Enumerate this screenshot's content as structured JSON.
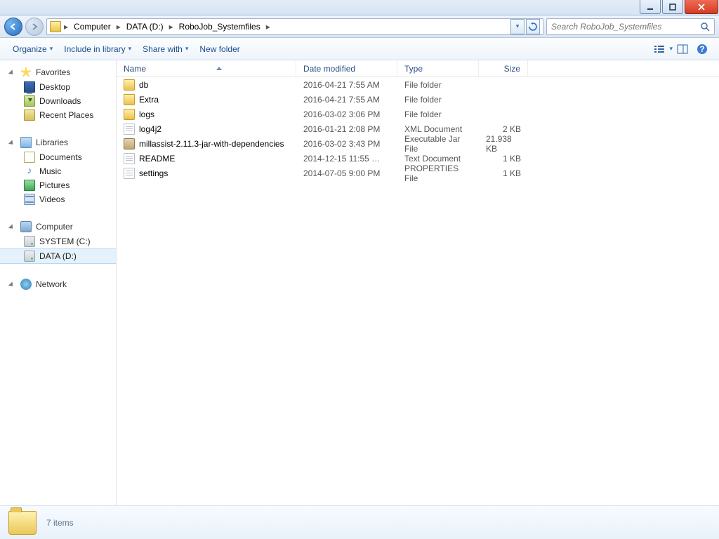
{
  "breadcrumbs": [
    "Computer",
    "DATA (D:)",
    "RoboJob_Systemfiles"
  ],
  "search_placeholder": "Search RoboJob_Systemfiles",
  "toolbar": {
    "organize": "Organize",
    "include": "Include in library",
    "share": "Share with",
    "newfolder": "New folder"
  },
  "nav": {
    "favorites": {
      "label": "Favorites",
      "items": [
        "Desktop",
        "Downloads",
        "Recent Places"
      ]
    },
    "libraries": {
      "label": "Libraries",
      "items": [
        "Documents",
        "Music",
        "Pictures",
        "Videos"
      ]
    },
    "computer": {
      "label": "Computer",
      "items": [
        "SYSTEM (C:)",
        "DATA (D:)"
      ],
      "selected": 1
    },
    "network": {
      "label": "Network"
    }
  },
  "columns": {
    "name": "Name",
    "date": "Date modified",
    "type": "Type",
    "size": "Size"
  },
  "files": [
    {
      "ic": "folder",
      "name": "db",
      "date": "2016-04-21 7:55 AM",
      "type": "File folder",
      "size": ""
    },
    {
      "ic": "folder",
      "name": "Extra",
      "date": "2016-04-21 7:55 AM",
      "type": "File folder",
      "size": ""
    },
    {
      "ic": "folder",
      "name": "logs",
      "date": "2016-03-02 3:06 PM",
      "type": "File folder",
      "size": ""
    },
    {
      "ic": "xml",
      "name": "log4j2",
      "date": "2016-01-21 2:08 PM",
      "type": "XML Document",
      "size": "2 KB"
    },
    {
      "ic": "jar",
      "name": "millassist-2.11.3-jar-with-dependencies",
      "date": "2016-03-02 3:43 PM",
      "type": "Executable Jar File",
      "size": "21.938 KB"
    },
    {
      "ic": "txt",
      "name": "README",
      "date": "2014-12-15 11:55 …",
      "type": "Text Document",
      "size": "1 KB"
    },
    {
      "ic": "prop",
      "name": "settings",
      "date": "2014-07-05 9:00 PM",
      "type": "PROPERTIES File",
      "size": "1 KB"
    }
  ],
  "status": "7 items"
}
